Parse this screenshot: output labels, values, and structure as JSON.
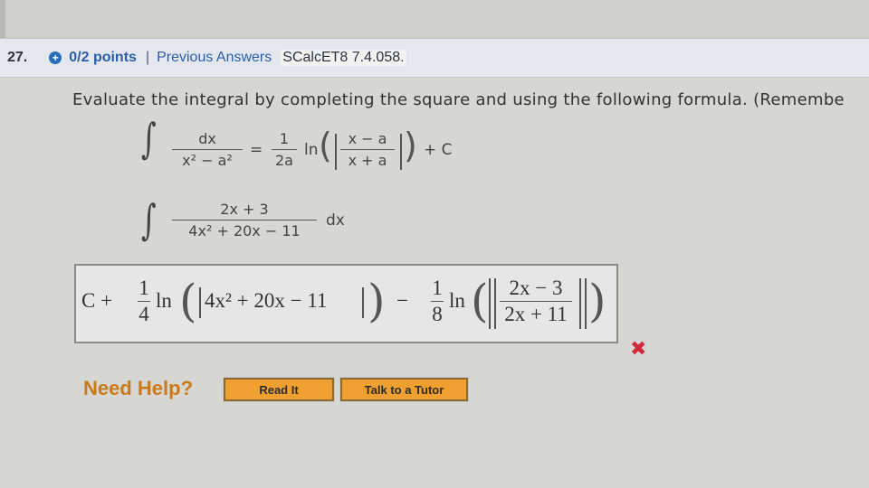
{
  "header": {
    "question_number": "27.",
    "plus_icon": "+",
    "points": "0/2 points",
    "separator": "|",
    "previous_answers": "Previous Answers",
    "source": "SCalcET8 7.4.058."
  },
  "prompt": "Evaluate the integral by completing the square and using the following formula. (Remembe",
  "formula": {
    "integral_symbol": "∫",
    "numerator": "dx",
    "denominator": "x² − a²",
    "equals": "=",
    "coef_num": "1",
    "coef_den": "2a",
    "ln": "ln",
    "inner_num": "x − a",
    "inner_den": "x + a",
    "plus_c": "+ C"
  },
  "problem": {
    "integral_symbol": "∫",
    "numerator": "2x + 3",
    "denominator": "4x² + 20x − 11",
    "dx": "dx"
  },
  "answer": {
    "c_plus": "C +",
    "frac1_num": "1",
    "frac1_den": "4",
    "ln1": "ln",
    "inner1": "4x² + 20x − 11",
    "minus": "−",
    "frac2_num": "1",
    "frac2_den": "8",
    "ln2": "ln",
    "inner2_num": "2x − 3",
    "inner2_den": "2x + 11"
  },
  "status": {
    "incorrect_icon": "✖"
  },
  "help": {
    "label": "Need Help?",
    "read_it": "Read It",
    "talk_to_tutor": "Talk to a Tutor"
  }
}
